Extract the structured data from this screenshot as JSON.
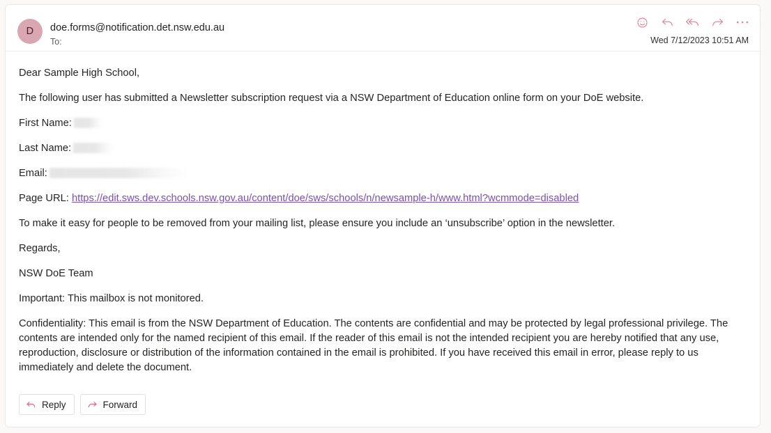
{
  "app": {
    "surface": "outlook-reading-pane"
  },
  "header": {
    "avatar_initial": "D",
    "sender_address": "doe.forms@notification.det.nsw.edu.au",
    "recipient_label": "To:",
    "timestamp": "Wed 7/12/2023 10:51 AM",
    "actions": [
      {
        "name": "react-emoji-icon",
        "icon": "smiley-icon",
        "title": "React"
      },
      {
        "name": "reply-icon",
        "icon": "reply-arrow-icon",
        "title": "Reply"
      },
      {
        "name": "reply-all-icon",
        "icon": "reply-all-arrow-icon",
        "title": "Reply all"
      },
      {
        "name": "forward-icon",
        "icon": "forward-arrow-icon",
        "title": "Forward"
      },
      {
        "name": "more-options-icon",
        "icon": "ellipsis-icon",
        "title": "More actions"
      }
    ]
  },
  "body": {
    "greeting": "Dear Sample High School,",
    "intro": "The following user has submitted a Newsletter subscription request via a NSW Department of Education online form on your DoE website.",
    "fields": [
      {
        "label": "First Name:",
        "value": "",
        "redacted": true
      },
      {
        "label": "Last Name:",
        "value": "",
        "redacted": true
      },
      {
        "label": "Email:",
        "value": "",
        "redacted": true
      }
    ],
    "page_url_label": "Page URL:",
    "page_url": "https://edit.sws.dev.schools.nsw.gov.au/content/doe/sws/schools/n/newsample-h/www.html?wcmmode=disabled",
    "unsubscribe_note": "To make it easy for people to be removed from your mailing list, please ensure you include an ‘unsubscribe’ option in the newsletter.",
    "regards": "Regards,",
    "signature": "NSW DoE Team",
    "important_note": "Important: This mailbox is not monitored.",
    "confidentiality": "Confidentiality: This email is from the NSW Department of Education. The contents are confidential and may be protected by legal professional privilege. The contents are intended only for the named recipient of this email. If the reader of this email is not the intended recipient you are hereby notified that any use, reproduction, disclosure or distribution of the information contained in the email is prohibited. If you have received this email in error, please reply to us immediately and delete the document."
  },
  "footer": {
    "reply_label": "Reply",
    "forward_label": "Forward"
  },
  "colors": {
    "accent_icon": "#e8798c",
    "button_icon": "#e8546b",
    "avatar_background": "#d9a7b2",
    "avatar_text": "#4a1f28",
    "link": "#7b4fb5",
    "body_text": "#252423",
    "secondary_text": "#605e5c",
    "card_background": "#ffffff",
    "page_background": "#faf9f8",
    "border": "#ebe9e7"
  }
}
